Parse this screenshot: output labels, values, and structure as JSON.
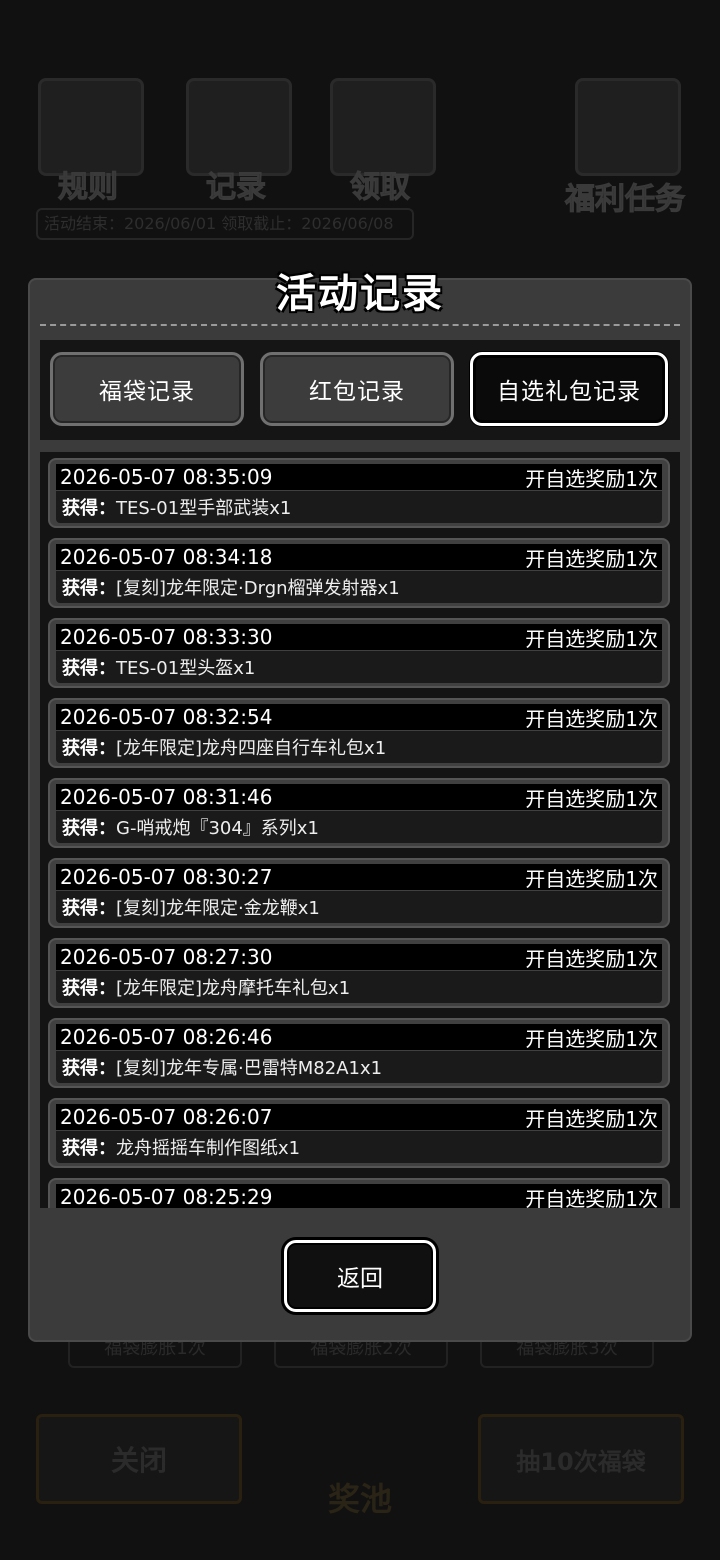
{
  "background": {
    "icons": [
      "规则",
      "记录",
      "领取",
      "福利任务"
    ],
    "notice": "活动结束：2026/06/01  领取截止：2026/06/08",
    "counters": [
      "福袋膨胀1次",
      "福袋膨胀2次",
      "福袋膨胀3次"
    ],
    "close_label": "关闭",
    "pool_label": "奖池",
    "draw10_label": "抽10次福袋"
  },
  "modal": {
    "title": "活动记录",
    "tabs": [
      {
        "label": "福袋记录",
        "active": false
      },
      {
        "label": "红包记录",
        "active": false
      },
      {
        "label": "自选礼包记录",
        "active": true
      }
    ],
    "obtained_prefix": "获得：",
    "records": [
      {
        "time": "2026-05-07 08:35:09",
        "action": "开自选奖励1次",
        "item": "TES-01型手部武装x1"
      },
      {
        "time": "2026-05-07 08:34:18",
        "action": "开自选奖励1次",
        "item": "[复刻]龙年限定·Drgn榴弹发射器x1"
      },
      {
        "time": "2026-05-07 08:33:30",
        "action": "开自选奖励1次",
        "item": "TES-01型头盔x1"
      },
      {
        "time": "2026-05-07 08:32:54",
        "action": "开自选奖励1次",
        "item": "[龙年限定]龙舟四座自行车礼包x1"
      },
      {
        "time": "2026-05-07 08:31:46",
        "action": "开自选奖励1次",
        "item": "G-哨戒炮『304』系列x1"
      },
      {
        "time": "2026-05-07 08:30:27",
        "action": "开自选奖励1次",
        "item": "[复刻]龙年限定·金龙鞭x1"
      },
      {
        "time": "2026-05-07 08:27:30",
        "action": "开自选奖励1次",
        "item": "[龙年限定]龙舟摩托车礼包x1"
      },
      {
        "time": "2026-05-07 08:26:46",
        "action": "开自选奖励1次",
        "item": "[复刻]龙年专属·巴雷特M82A1x1"
      },
      {
        "time": "2026-05-07 08:26:07",
        "action": "开自选奖励1次",
        "item": "龙舟摇摇车制作图纸x1"
      },
      {
        "time": "2026-05-07 08:25:29",
        "action": "开自选奖励1次",
        "item": ""
      }
    ],
    "back_label": "返回"
  }
}
